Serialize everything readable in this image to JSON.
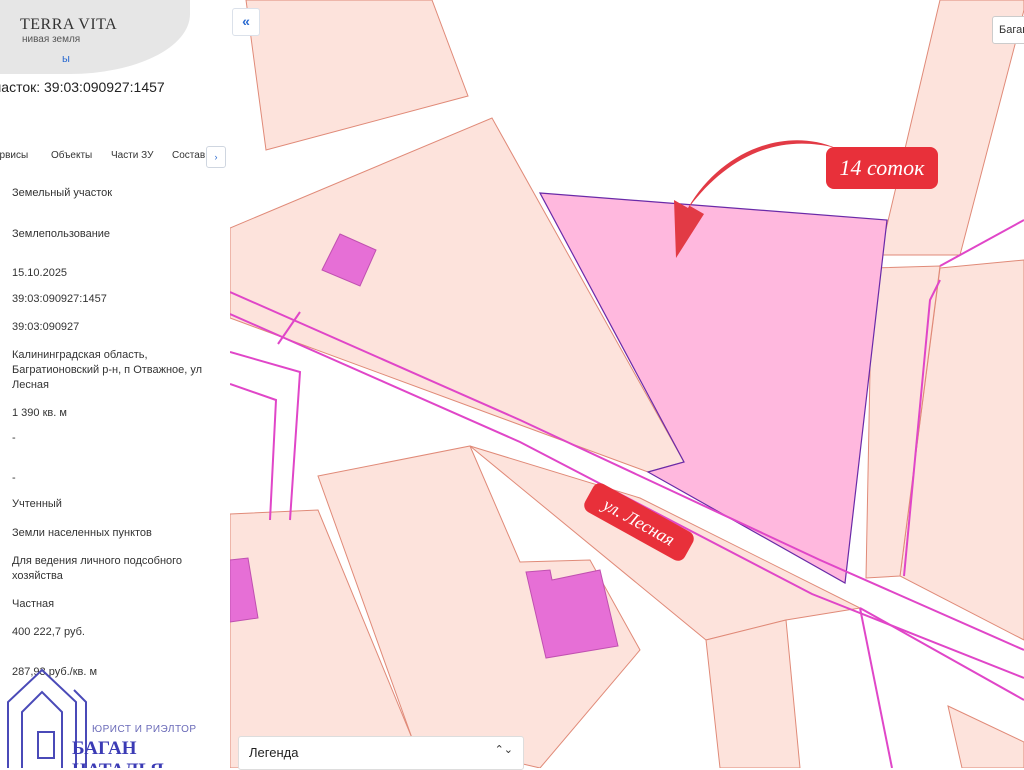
{
  "logo": {
    "title": "TERRA VITA",
    "subtitle": "нивая земля",
    "link_fragment": "ы"
  },
  "parcel_title": "часток: 39:03:090927:1457",
  "tabs": [
    "ервисы",
    "Объекты",
    "Части ЗУ",
    "Состав"
  ],
  "tab_more_label": "›",
  "properties": [
    "Земельный участок",
    "Землепользование",
    "15.10.2025",
    "39:03:090927:1457",
    "39:03:090927",
    "Калининградская область, Багратионовский р-н, п Отважное, ул Лесная",
    "1 390 кв. м",
    "-",
    "-",
    "Учтенный",
    "Земли населенных пунктов",
    "Для ведения личного подсобного хозяйства",
    "Частная",
    "400 222,7 руб.",
    "287,93 руб./кв. м"
  ],
  "watermark": {
    "role": "ЮРИСТ И РИЭЛТОР",
    "name": "БАГАН НАТАЛЬЯ"
  },
  "map": {
    "collapse_label": "«",
    "search_value": "Баган",
    "legend_label": "Легенда",
    "legend_chevron": "⌃⌄",
    "annotation_area": "14 соток",
    "annotation_street": "ул. Лесная",
    "colors": {
      "parcel_fill": "#fde3dc",
      "parcel_stroke": "#e08a78",
      "selected_fill": "#ffb8de",
      "selected_stroke": "#6a2aa8",
      "building_fill": "#e66fd6",
      "road_line": "#e046c8",
      "annotation": "#e8303a"
    }
  }
}
